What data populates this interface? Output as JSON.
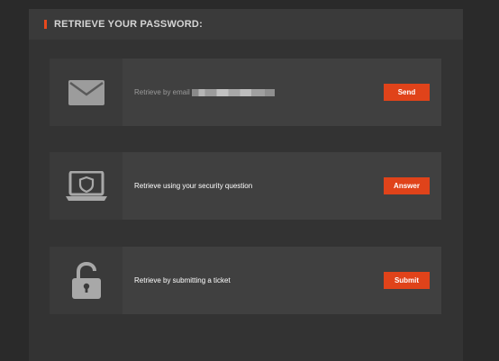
{
  "header": {
    "title": "RETRIEVE YOUR PASSWORD:"
  },
  "options": [
    {
      "icon": "envelope-icon",
      "label": "Retrieve by email",
      "button": "Send"
    },
    {
      "icon": "laptop-shield-icon",
      "label": "Retrieve using your security question",
      "button": "Answer"
    },
    {
      "icon": "unlocked-padlock-icon",
      "label": "Retrieve by submitting a ticket",
      "button": "Submit"
    }
  ],
  "colors": {
    "accent": "#e8491d",
    "button": "#e0431a",
    "background": "#2a2a2a",
    "panel": "#333333"
  }
}
